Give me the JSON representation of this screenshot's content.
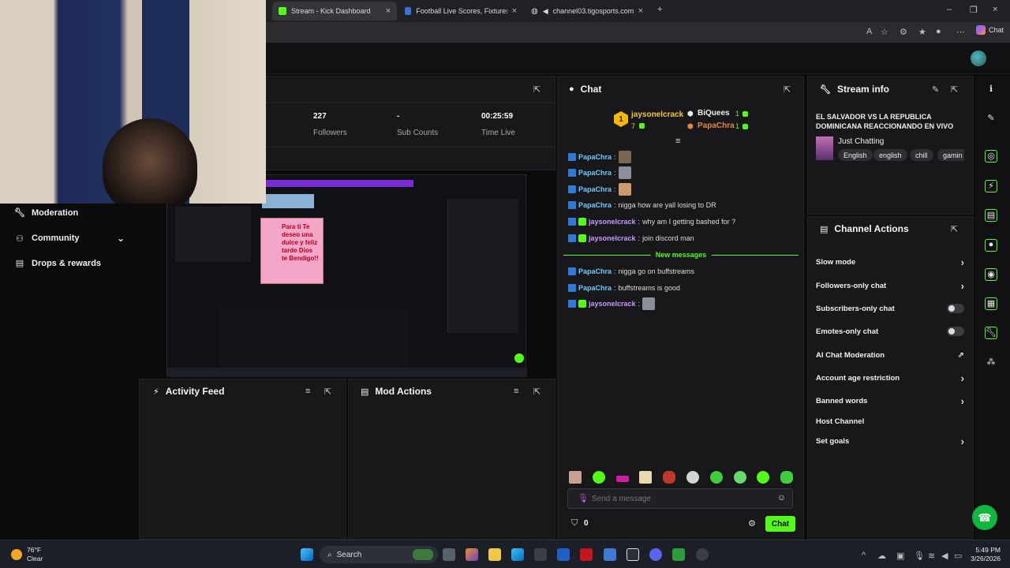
{
  "browser": {
    "tabs": [
      {
        "label": "Stream - Kick Dashboard",
        "active": true
      },
      {
        "label": "Football Live Scores, Fixtures & Or",
        "active": false
      },
      {
        "label": "channel03.tigosports.com.sv/",
        "active": false
      }
    ],
    "chat_button": "Chat"
  },
  "sidebar": {
    "items": [
      {
        "label": "Moderation",
        "icon": "wrench-icon"
      },
      {
        "label": "Community",
        "icon": "people-icon"
      },
      {
        "label": "Drops & rewards",
        "icon": "gift-icon"
      }
    ]
  },
  "stats": [
    {
      "value": "227",
      "label": "Followers"
    },
    {
      "value": "-",
      "label": "Sub Counts"
    },
    {
      "value": "00:25:59",
      "label": "Time Live"
    }
  ],
  "panels": {
    "activity_feed": "Activity Feed",
    "mod_actions": "Mod Actions",
    "chat": "Chat",
    "stream_info": "Stream info",
    "channel_actions": "Channel Actions"
  },
  "leaderboard": {
    "top": {
      "rank": "1",
      "name": "jaysonelcrack",
      "count": "7"
    },
    "others": [
      {
        "name": "BiQuees",
        "count": "1"
      },
      {
        "name": "PapaChra",
        "count": "1"
      }
    ]
  },
  "chat": {
    "messages": [
      {
        "user": "PapaChra",
        "text": "",
        "emote": true
      },
      {
        "user": "PapaChra",
        "text": "",
        "emote": true
      },
      {
        "user": "PapaChra",
        "text": "",
        "emote": true
      },
      {
        "user": "PapaChra",
        "text": "nigga how are yall losing to DR",
        "emote": false
      },
      {
        "user": "jaysonelcrack",
        "text": "why am I getting bashed for ?",
        "emote": false
      },
      {
        "user": "jaysonelcrack",
        "text": "join discord man",
        "emote": false
      },
      {
        "user": "PapaChra",
        "text": "nigga go on buffstreams",
        "emote": false
      },
      {
        "user": "PapaChra",
        "text": "buffstreams is good",
        "emote": false
      },
      {
        "user": "jaysonelcrack",
        "text": "",
        "emote": true
      }
    ],
    "new_messages_label": "New messages",
    "input_placeholder": "Send a message",
    "points": "0",
    "send_label": "Chat"
  },
  "stream_info": {
    "title": "EL SALVADOR VS LA REPUBLICA DOMINICANA REACCIONANDO EN VIVO",
    "category": "Just Chatting",
    "tags": [
      "English",
      "english",
      "chill",
      "gamin"
    ]
  },
  "channel_actions": [
    {
      "label": "Slow mode",
      "control": "chevron"
    },
    {
      "label": "Followers-only chat",
      "control": "chevron"
    },
    {
      "label": "Subscribers-only chat",
      "control": "toggle"
    },
    {
      "label": "Emotes-only chat",
      "control": "toggle"
    },
    {
      "label": "AI Chat Moderation",
      "control": "external"
    },
    {
      "label": "Account age restriction",
      "control": "chevron"
    },
    {
      "label": "Banned words",
      "control": "chevron"
    },
    {
      "label": "Host Channel",
      "control": "none"
    },
    {
      "label": "Set goals",
      "control": "chevron"
    }
  ],
  "screen_share": {
    "stream_text": "Para ti Te deseo una dulce y feliz tarde Dios te Bendigo!!"
  },
  "taskbar": {
    "weather_temp": "76°F",
    "weather_desc": "Clear",
    "search_label": "Search",
    "time": "5:49 PM",
    "date": "3/26/2026"
  },
  "colors": {
    "accent": "#53fc18",
    "panel_bg": "#18181b",
    "page_bg": "#0b0b0c"
  }
}
